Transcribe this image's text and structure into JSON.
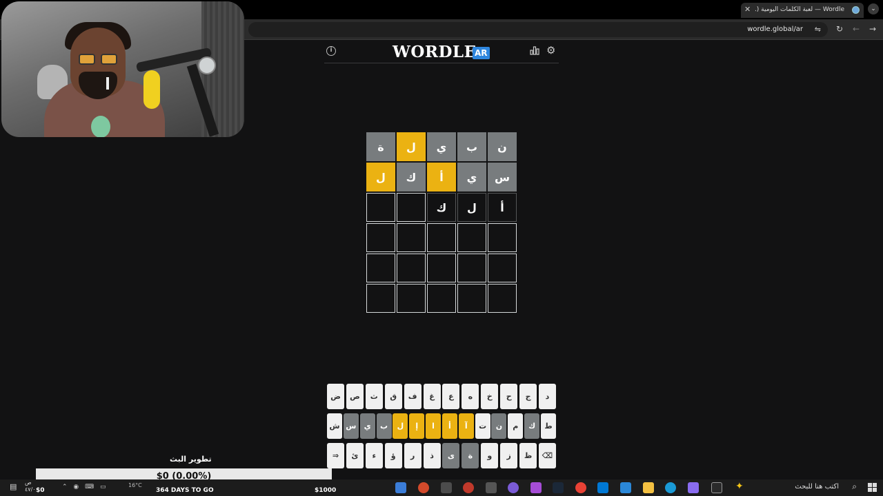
{
  "browser": {
    "tab_title": "Wordle — لعبة الكلمات اليومية (...",
    "tab_close": "✕",
    "new_tab": "+",
    "url": "wordle.global/ar"
  },
  "header": {
    "title": "WORDLE",
    "lang_badge": "AR"
  },
  "board": {
    "rows": [
      [
        {
          "letter": "ن",
          "state": "absent"
        },
        {
          "letter": "ب",
          "state": "absent"
        },
        {
          "letter": "ي",
          "state": "absent"
        },
        {
          "letter": "ل",
          "state": "present"
        },
        {
          "letter": "ة",
          "state": "absent"
        }
      ],
      [
        {
          "letter": "س",
          "state": "absent"
        },
        {
          "letter": "ي",
          "state": "absent"
        },
        {
          "letter": "أ",
          "state": "present"
        },
        {
          "letter": "ك",
          "state": "absent"
        },
        {
          "letter": "ل",
          "state": "present"
        }
      ],
      [
        {
          "letter": "أ",
          "state": "filled"
        },
        {
          "letter": "ل",
          "state": "filled"
        },
        {
          "letter": "ك",
          "state": "filled"
        },
        {
          "letter": "",
          "state": "empty"
        },
        {
          "letter": "",
          "state": "empty"
        }
      ],
      [
        {
          "letter": "",
          "state": "empty"
        },
        {
          "letter": "",
          "state": "empty"
        },
        {
          "letter": "",
          "state": "empty"
        },
        {
          "letter": "",
          "state": "empty"
        },
        {
          "letter": "",
          "state": "empty"
        }
      ],
      [
        {
          "letter": "",
          "state": "empty"
        },
        {
          "letter": "",
          "state": "empty"
        },
        {
          "letter": "",
          "state": "empty"
        },
        {
          "letter": "",
          "state": "empty"
        },
        {
          "letter": "",
          "state": "empty"
        }
      ],
      [
        {
          "letter": "",
          "state": "empty"
        },
        {
          "letter": "",
          "state": "empty"
        },
        {
          "letter": "",
          "state": "empty"
        },
        {
          "letter": "",
          "state": "empty"
        },
        {
          "letter": "",
          "state": "empty"
        }
      ]
    ]
  },
  "keyboard": {
    "rows": [
      [
        {
          "key": "د",
          "state": "light"
        },
        {
          "key": "ج",
          "state": "light"
        },
        {
          "key": "ح",
          "state": "light"
        },
        {
          "key": "خ",
          "state": "light"
        },
        {
          "key": "ه",
          "state": "light"
        },
        {
          "key": "ع",
          "state": "light"
        },
        {
          "key": "غ",
          "state": "light"
        },
        {
          "key": "ف",
          "state": "light"
        },
        {
          "key": "ق",
          "state": "light"
        },
        {
          "key": "ث",
          "state": "light"
        },
        {
          "key": "ص",
          "state": "light"
        },
        {
          "key": "ض",
          "state": "light"
        }
      ],
      [
        {
          "key": "ط",
          "state": "light"
        },
        {
          "key": "ك",
          "state": "absent"
        },
        {
          "key": "م",
          "state": "light"
        },
        {
          "key": "ن",
          "state": "absent"
        },
        {
          "key": "ت",
          "state": "light"
        },
        {
          "key": "آ",
          "state": "present"
        },
        {
          "key": "أ",
          "state": "present"
        },
        {
          "key": "ا",
          "state": "present"
        },
        {
          "key": "إ",
          "state": "present"
        },
        {
          "key": "ل",
          "state": "present"
        },
        {
          "key": "ب",
          "state": "absent"
        },
        {
          "key": "ي",
          "state": "absent"
        },
        {
          "key": "س",
          "state": "absent"
        },
        {
          "key": "ش",
          "state": "light"
        }
      ],
      [
        {
          "key": "⌫",
          "state": "light"
        },
        {
          "key": "ظ",
          "state": "light"
        },
        {
          "key": "ز",
          "state": "light"
        },
        {
          "key": "و",
          "state": "light"
        },
        {
          "key": "ة",
          "state": "absent"
        },
        {
          "key": "ى",
          "state": "absent"
        },
        {
          "key": "ذ",
          "state": "light"
        },
        {
          "key": "ر",
          "state": "light"
        },
        {
          "key": "ؤ",
          "state": "light"
        },
        {
          "key": "ء",
          "state": "light"
        },
        {
          "key": "ئ",
          "state": "light"
        },
        {
          "key": "⇒",
          "state": "light"
        }
      ]
    ]
  },
  "stream_overlay": {
    "goal_label": "تطوير البث",
    "goal_text": "$0 (0.00%)",
    "goal_progress": 0,
    "goal_min": "$0",
    "goal_days": "364 DAYS TO GO",
    "goal_max": "$1000"
  },
  "taskbar": {
    "search_placeholder": "اكتب هنا للبحث",
    "weather": "16°C"
  },
  "colors": {
    "absent": "#787c7e",
    "present": "#ebb212",
    "background": "#121213",
    "badge": "#2e86de"
  }
}
